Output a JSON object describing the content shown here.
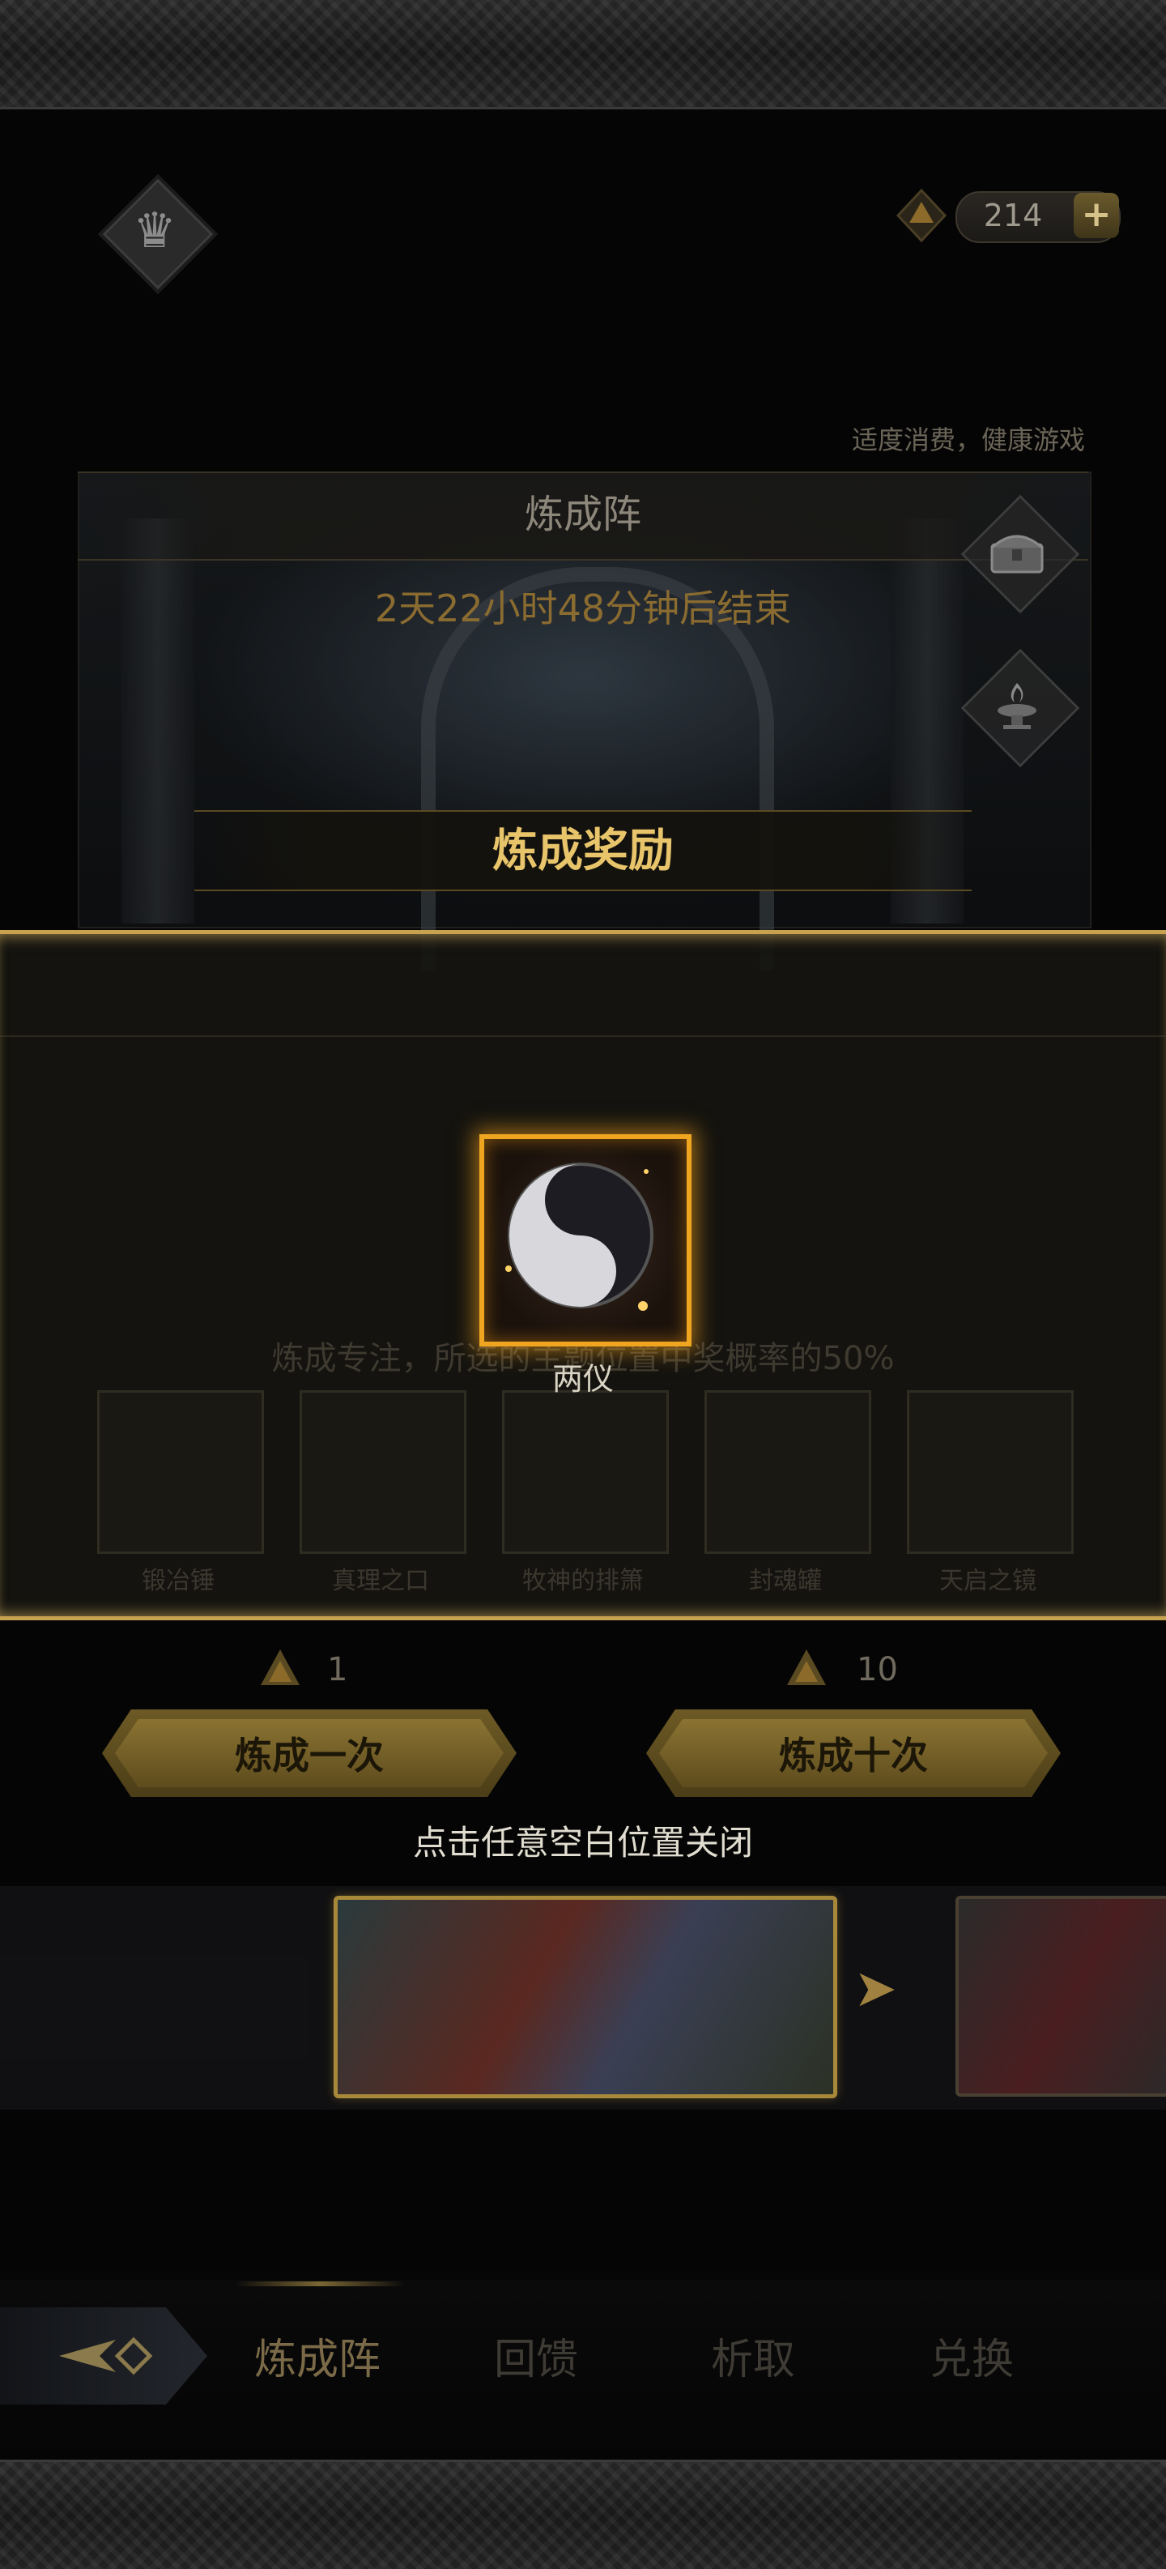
{
  "header": {
    "currency_value": "214",
    "currency_plus": "+",
    "notice": "适度消费，健康游戏"
  },
  "panel": {
    "title": "炼成阵",
    "countdown": "2天22小时48分钟后结束"
  },
  "background_ghost": {
    "focus_text": "炼成专注，所选的主题位置中奖概率的50%",
    "slots": [
      "锻冶锤",
      "真理之口",
      "牧神的排箫",
      "封魂罐",
      "天启之镜"
    ]
  },
  "reward_modal": {
    "title": "炼成奖励",
    "item_name": "两仪",
    "close_hint": "点击任意空白位置关闭"
  },
  "actions": {
    "once": {
      "cost": "1",
      "label": "炼成一次"
    },
    "ten": {
      "cost": "10",
      "label": "炼成十次"
    }
  },
  "carousel": {
    "arrow": "➤"
  },
  "tabs": [
    "炼成阵",
    "回馈",
    "析取",
    "兑换"
  ],
  "colors": {
    "gold_accent": "#c9a24f",
    "frame_orange": "#f0a520",
    "title_gold": "#e8c46a"
  },
  "icons": {
    "crown": "crown-icon",
    "chest": "treasure-chest-icon",
    "brazier": "brazier-icon",
    "currency": "alchemy-crystal-icon"
  }
}
